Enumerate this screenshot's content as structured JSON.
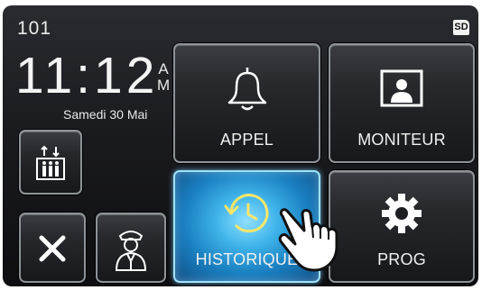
{
  "status": {
    "unit_number": "101",
    "sd_label": "SD"
  },
  "clock": {
    "time": "11:12",
    "am_pm_top": "A",
    "am_pm_bottom": "M",
    "date": "Samedi 30 Mai"
  },
  "buttons": {
    "appel": "APPEL",
    "moniteur": "MONITEUR",
    "historique": "HISTORIQUE",
    "prog": "PROG"
  },
  "icons": {
    "elevator": "elevator-icon",
    "close": "close-icon",
    "concierge": "concierge-icon",
    "bell": "bell-icon",
    "monitor": "monitor-person-icon",
    "history": "history-clock-icon",
    "gear": "gear-icon",
    "hand": "pointing-hand-icon"
  },
  "colors": {
    "background": "#1a1b1f",
    "highlight": "#3fb4ea",
    "text": "#f0f0f0"
  }
}
